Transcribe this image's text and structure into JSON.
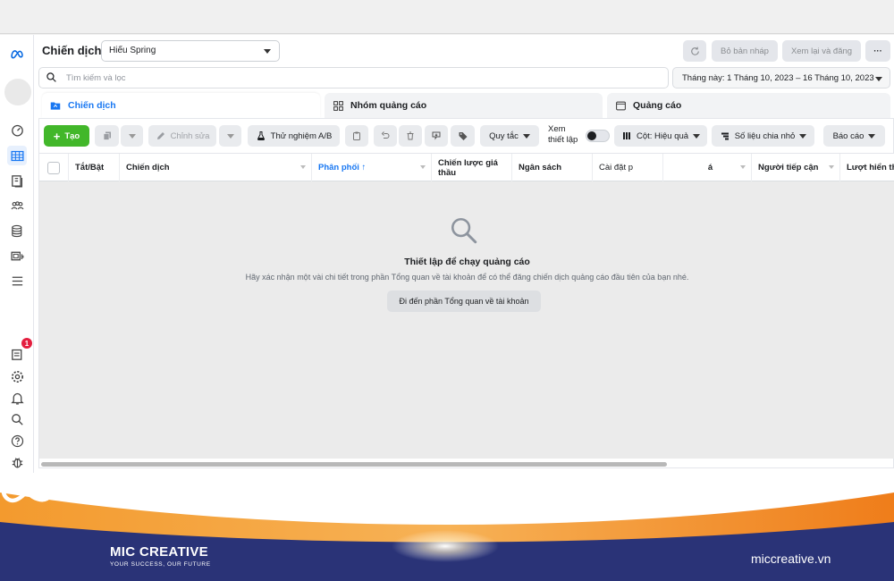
{
  "header": {
    "title": "Chiến dịch",
    "account": "Hiếu Spring",
    "discard_label": "Bỏ bản nháp",
    "review_label": "Xem lại và đăng",
    "more_label": "···"
  },
  "search": {
    "placeholder": "Tìm kiếm và lọc"
  },
  "date_range": "Tháng này: 1 Tháng 10, 2023 – 16 Tháng 10, 2023",
  "tabs": [
    {
      "label": "Chiến dịch"
    },
    {
      "label": "Nhóm quảng cáo"
    },
    {
      "label": "Quảng cáo"
    }
  ],
  "toolbar": {
    "create": "Tạo",
    "edit": "Chỉnh sửa",
    "ab_test": "Thử nghiệm A/B",
    "rules": "Quy tắc",
    "view_setup": [
      "Xem",
      "thiết lập"
    ],
    "columns": "Cột: Hiệu quả",
    "breakdown": "Số liệu chia nhỏ",
    "reports": "Báo cáo"
  },
  "table": {
    "columns": [
      "Tắt/Bật",
      "Chiến dịch",
      "Phân phối ↑",
      "Chiến lược giá thầu",
      "Ngân sách",
      "Cài đặt p",
      "á",
      "Người tiếp cận",
      "Lượt hiển th"
    ]
  },
  "empty_state": {
    "title": "Thiết lập để chạy quảng cáo",
    "subtitle": "Hãy xác nhận một vài chi tiết trong phần Tổng quan về tài khoản để có thể đăng chiến dịch quảng cáo đầu tiên của bạn nhé.",
    "button": "Đi đến phần Tổng quan về tài khoản"
  },
  "rail": {
    "notification_count": "1",
    "icons": [
      "meta-logo-icon",
      "dashboard-icon",
      "table-icon",
      "pages-icon",
      "audience-icon",
      "billing-icon",
      "media-icon",
      "menu-icon",
      "notes-icon",
      "settings-icon",
      "bell-icon",
      "search-icon",
      "help-icon",
      "bug-icon"
    ]
  },
  "footer": {
    "brand": "MIC CREATIVE",
    "tagline": "YOUR SUCCESS, OUR FUTURE",
    "website": "miccreative.vn"
  },
  "colors": {
    "accent": "#1877f2",
    "create_green": "#42b72a",
    "footer_navy": "#2a3377",
    "footer_orange": "#f28a1f"
  }
}
